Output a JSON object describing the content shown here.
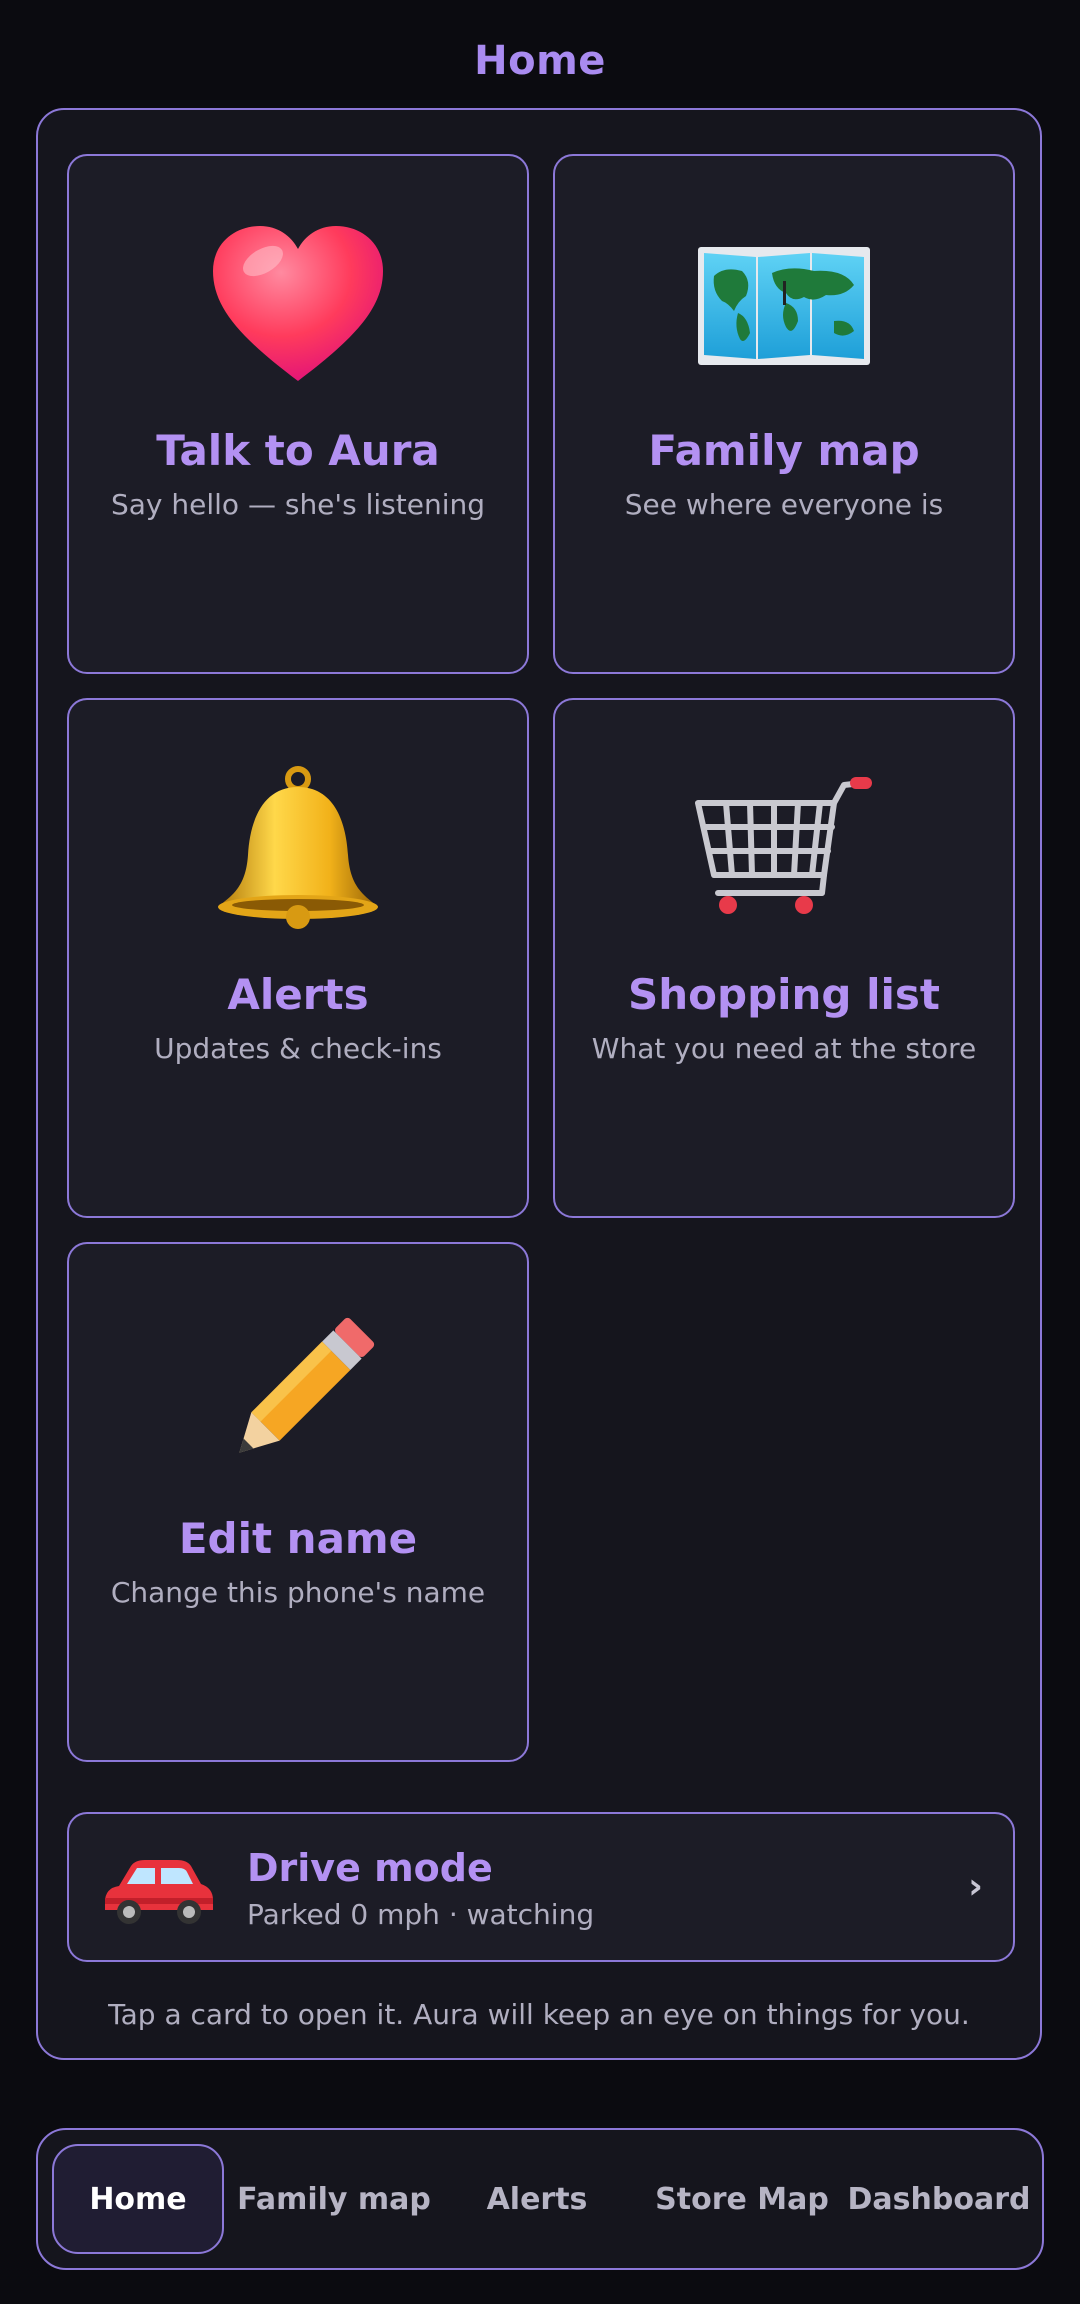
{
  "header": {
    "title": "Home"
  },
  "cards": [
    {
      "icon": "heart-icon",
      "title": "Talk to Aura",
      "subtitle": "Say hello — she's listening"
    },
    {
      "icon": "world-map-icon",
      "title": "Family map",
      "subtitle": "See where everyone is"
    },
    {
      "icon": "bell-icon",
      "title": "Alerts",
      "subtitle": "Updates & check-ins"
    },
    {
      "icon": "shopping-cart-icon",
      "title": "Shopping list",
      "subtitle": "What you need at the store"
    },
    {
      "icon": "pencil-icon",
      "title": "Edit name",
      "subtitle": "Change this phone's name"
    }
  ],
  "drive": {
    "icon": "car-icon",
    "title": "Drive mode",
    "status": "Parked 0 mph · watching",
    "chevron": "›"
  },
  "hint": "Tap a card to open it. Aura will keep an eye on things for you.",
  "tabs": [
    {
      "label": "Home",
      "active": true
    },
    {
      "label": "Family map"
    },
    {
      "label": "Alerts"
    },
    {
      "label": "Store Map"
    },
    {
      "label": "Dashboard"
    }
  ],
  "colors": {
    "accent": "#a98bf0",
    "border": "#8c78d8",
    "background": "#0b0b10",
    "card": "#1c1c26"
  }
}
